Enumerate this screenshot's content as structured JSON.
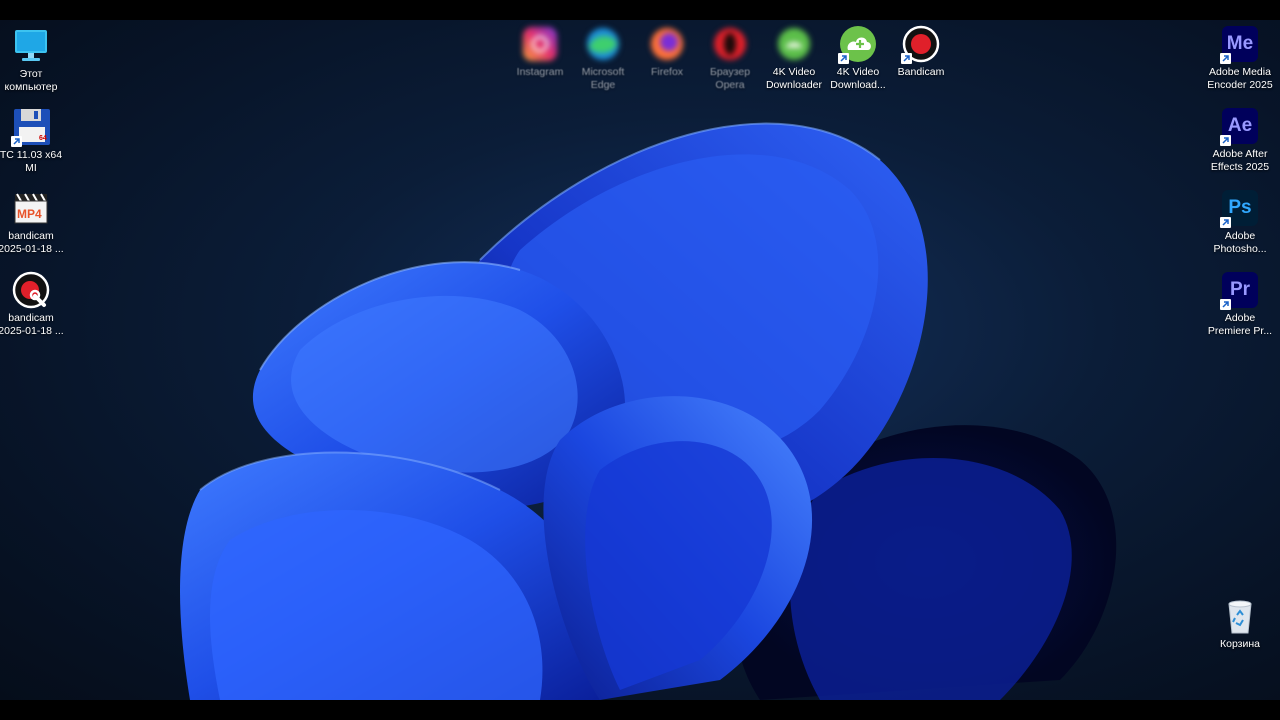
{
  "desktop": {
    "left_icons": [
      {
        "label": "Этот\nкомпьютер",
        "icon": "monitor-icon"
      },
      {
        "label": "TC 11.03 x64\nMI",
        "icon": "floppy-disk-icon"
      },
      {
        "label": "bandicam\n2025-01-18 ...",
        "icon": "mp4-clapper-icon"
      },
      {
        "label": "bandicam\n2025-01-18 ...",
        "icon": "bandicam-tools-icon"
      }
    ],
    "top_icons": [
      {
        "label": "Instagram",
        "icon": "instagram-icon"
      },
      {
        "label": "Microsoft\nEdge",
        "icon": "edge-icon"
      },
      {
        "label": "Firefox",
        "icon": "firefox-icon"
      },
      {
        "label": "Браузер\nOpera",
        "icon": "opera-icon"
      },
      {
        "label": "4K Video\nDownloader",
        "icon": "4k-video-downloader-icon"
      },
      {
        "label": "4K Video\nDownload...",
        "icon": "4k-video-downloader-plus-icon"
      },
      {
        "label": "Bandicam",
        "icon": "bandicam-icon"
      }
    ],
    "right_icons": [
      {
        "label": "Adobe Media\nEncoder 2025",
        "icon": "media-encoder-icon",
        "glyph": "Me",
        "color": "#9999ff"
      },
      {
        "label": "Adobe After\nEffects 2025",
        "icon": "after-effects-icon",
        "glyph": "Ae",
        "color": "#9999ff"
      },
      {
        "label": "Adobe\nPhotosho...",
        "icon": "photoshop-icon",
        "glyph": "Ps",
        "color": "#31a8ff"
      },
      {
        "label": "Adobe\nPremiere Pr...",
        "icon": "premiere-pro-icon",
        "glyph": "Pr",
        "color": "#9999ff"
      }
    ],
    "recycle_bin": {
      "label": "Корзина",
      "icon": "recycle-bin-icon"
    }
  },
  "colors": {
    "wallpaper_blue": "#1a4fe0",
    "adobe_bg": "#00005b"
  }
}
